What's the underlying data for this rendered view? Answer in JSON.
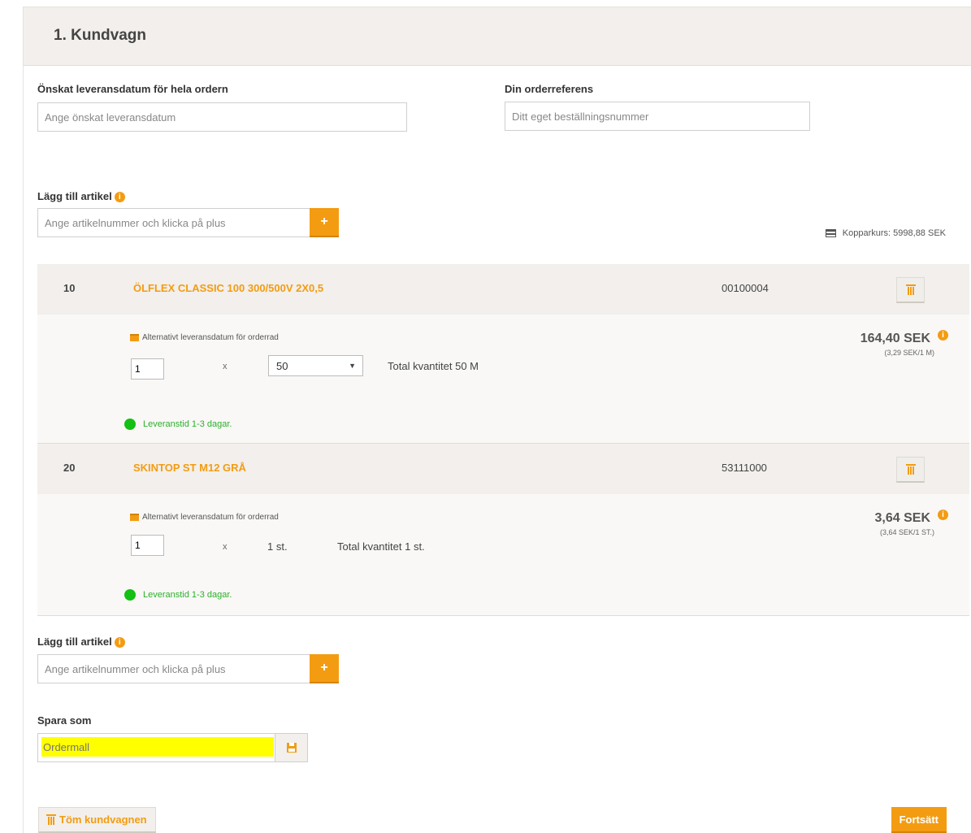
{
  "header": {
    "title": "1. Kundvagn"
  },
  "delivery_date": {
    "label": "Önskat leveransdatum för hela ordern",
    "placeholder": "Ange önskat leveransdatum"
  },
  "order_ref": {
    "label": "Din orderreferens",
    "placeholder": "Ditt eget beställningsnummer"
  },
  "add_article_top": {
    "label": "Lägg till artikel",
    "placeholder": "Ange artikelnummer och klicka på plus",
    "button": "+"
  },
  "copper": {
    "text": "Kopparkurs: 5998,88 SEK"
  },
  "info_glyph": "i",
  "rows": [
    {
      "position": "10",
      "name": "ÖLFLEX CLASSIC 100 300/500V 2X0,5",
      "article_no": "00100004",
      "alt_date": "Alternativt leveransdatum för orderrad",
      "quantity": "1",
      "times": "x",
      "length_option": "50",
      "total": "Total kvantitet 50 M",
      "price": "164,40 SEK",
      "unit_price": "(3,29 SEK/1 M)",
      "delivery": "Leveranstid 1-3 dagar."
    },
    {
      "position": "20",
      "name": "SKINTOP ST M12 GRÅ",
      "article_no": "53111000",
      "alt_date": "Alternativt leveransdatum för orderrad",
      "quantity": "1",
      "times": "x",
      "unit": "1 st.",
      "total": "Total kvantitet 1 st.",
      "price": "3,64 SEK",
      "unit_price": "(3,64 SEK/1 ST.)",
      "delivery": "Leveranstid 1-3 dagar."
    }
  ],
  "add_article_bottom": {
    "label": "Lägg till artikel",
    "placeholder": "Ange artikelnummer och klicka på plus",
    "button": "+"
  },
  "save_as": {
    "label": "Spara som",
    "placeholder": "Ordermall"
  },
  "footer": {
    "empty_cart": "Töm kundvagnen",
    "continue": "Fortsätt"
  },
  "colors": {
    "accent": "#f39c12",
    "header_bg": "#f2efec",
    "delivery_green": "#13c013",
    "highlight": "#ffff00"
  }
}
